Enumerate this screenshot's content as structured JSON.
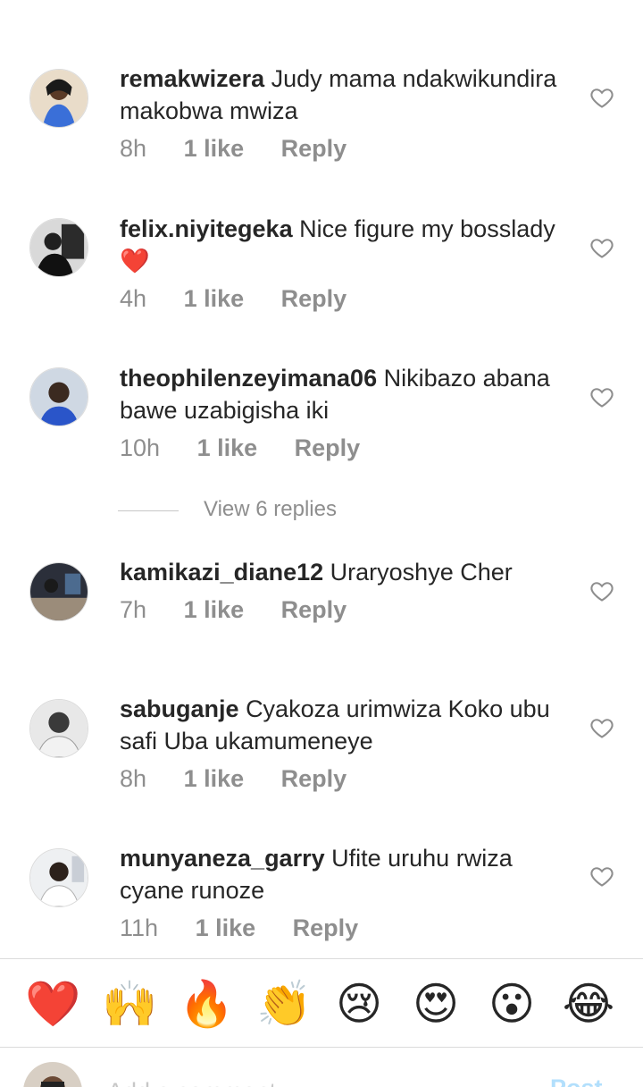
{
  "comments": [
    {
      "username": "remakwizera",
      "text": "Judy mama ndakwikundira makobwa mwiza",
      "time": "8h",
      "likes": "1 like",
      "reply": "Reply"
    },
    {
      "username": "felix.niyitegeka",
      "text": "Nice figure my bosslady ❤️",
      "time": "4h",
      "likes": "1 like",
      "reply": "Reply"
    },
    {
      "username": "theophilenzeyimana06",
      "text": "Nikibazo abana bawe uzabigisha iki",
      "time": "10h",
      "likes": "1 like",
      "reply": "Reply"
    },
    {
      "username": "kamikazi_diane12",
      "text": "Uraryoshye Cher",
      "time": "7h",
      "likes": "1 like",
      "reply": "Reply"
    },
    {
      "username": "sabuganje",
      "text": "Cyakoza urimwiza Koko ubu safi Uba ukamumeneye",
      "time": "8h",
      "likes": "1 like",
      "reply": "Reply"
    },
    {
      "username": "munyaneza_garry",
      "text": "Ufite uruhu rwiza cyane runoze",
      "time": "11h",
      "likes": "1 like",
      "reply": "Reply"
    }
  ],
  "view_replies": "View 6 replies",
  "emoji_bar": [
    "❤️",
    "🙌",
    "🔥",
    "👏",
    "😢",
    "😍",
    "😮",
    "😂"
  ],
  "composer": {
    "placeholder": "Add a comment...",
    "post_label": "Post"
  },
  "icons": {
    "like": "heart-outline-icon"
  },
  "colors": {
    "text": "#262626",
    "secondary": "#8e8e8e",
    "divider": "#dbdbdb",
    "post_disabled": "#b2dffc"
  }
}
